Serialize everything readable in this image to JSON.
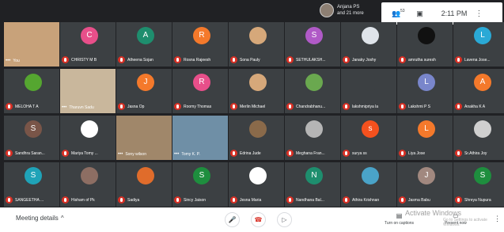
{
  "presenter": {
    "name": "Anjana PS",
    "subtitle": "and 21 more"
  },
  "top_right": {
    "people_count": "53",
    "time": "2:11 PM"
  },
  "colors": {
    "mute_red": "#d93025",
    "tile_bg": "#3c4043",
    "page_bg": "#202124"
  },
  "participants": [
    {
      "name": "You",
      "initial": "",
      "color": "#c8a27a",
      "kind": "photo",
      "muted": false
    },
    {
      "name": "CHRISTY M B",
      "initial": "C",
      "color": "#e84f8a",
      "muted": true
    },
    {
      "name": "Atheena Sojan",
      "initial": "A",
      "color": "#1e8e6e",
      "muted": true
    },
    {
      "name": "Rosna Rajeesh",
      "initial": "R",
      "color": "#f4792b",
      "muted": true
    },
    {
      "name": "Sona Pauly",
      "initial": "",
      "color": "#d6a87a",
      "muted": true
    },
    {
      "name": "SETHULAKSH...",
      "initial": "S",
      "color": "#b05ac7",
      "muted": true
    },
    {
      "name": "Janaky Joshy",
      "initial": "",
      "color": "#dfe4ea",
      "muted": true
    },
    {
      "name": "amrutha suresh",
      "initial": "",
      "color": "#111111",
      "muted": true
    },
    {
      "name": "Lavena Jose...",
      "initial": "L",
      "color": "#2aa9d6",
      "muted": true
    },
    {
      "name": "MELOHA T A",
      "initial": "",
      "color": "#55a630",
      "muted": true
    },
    {
      "name": "Tharuvn Sadu",
      "initial": "",
      "color": "#c9b79c",
      "kind": "video",
      "muted": false
    },
    {
      "name": "Jasna Op",
      "initial": "J",
      "color": "#f4792b",
      "muted": true
    },
    {
      "name": "Roomy Thomas",
      "initial": "R",
      "color": "#e84f8a",
      "muted": true
    },
    {
      "name": "Merlin Michael",
      "initial": "",
      "color": "#d6a87a",
      "muted": true
    },
    {
      "name": "Chandrabhanu...",
      "initial": "",
      "color": "#6aa84f",
      "muted": true
    },
    {
      "name": "lakshmipriya la",
      "initial": "",
      "color": "#3c4043",
      "muted": true
    },
    {
      "name": "Lakshmi P S",
      "initial": "L",
      "color": "#7986cb",
      "muted": true
    },
    {
      "name": "Anakha K A",
      "initial": "A",
      "color": "#f4792b",
      "muted": true
    },
    {
      "name": "Sandhra Saran...",
      "initial": "S",
      "color": "#795548",
      "muted": true
    },
    {
      "name": "Mariya Tomy ...",
      "initial": "",
      "color": "#ffffff",
      "muted": true
    },
    {
      "name": "Sony wilson",
      "initial": "",
      "color": "#a0876a",
      "kind": "video",
      "muted": false
    },
    {
      "name": "Tomy K. P.",
      "initial": "",
      "color": "#6f8fa6",
      "kind": "video",
      "muted": false
    },
    {
      "name": "Edrina Jude",
      "initial": "",
      "color": "#8a6a4a",
      "muted": true
    },
    {
      "name": "Meghana Fran...",
      "initial": "",
      "color": "#b5b5b5",
      "muted": true
    },
    {
      "name": "surya ss",
      "initial": "s",
      "color": "#f4511e",
      "muted": true
    },
    {
      "name": "Liya Jose",
      "initial": "L",
      "color": "#f4792b",
      "muted": true
    },
    {
      "name": "Sr.Athira Joy",
      "initial": "",
      "color": "#cfcfcf",
      "muted": true
    },
    {
      "name": "SANGEETHA ...",
      "initial": "S",
      "color": "#1fa3b8",
      "muted": true
    },
    {
      "name": "Hisham of Pk",
      "initial": "",
      "color": "#8d6e63",
      "muted": true
    },
    {
      "name": "Sadiya",
      "initial": "",
      "color": "#e06c2b",
      "muted": true
    },
    {
      "name": "Sincy Jaison",
      "initial": "S",
      "color": "#1e8e3e",
      "muted": true
    },
    {
      "name": "Jesna Maria",
      "initial": "",
      "color": "#ffffff",
      "muted": true
    },
    {
      "name": "Nandhana Bal...",
      "initial": "N",
      "color": "#1e8e6e",
      "muted": true
    },
    {
      "name": "Athira Krishnan",
      "initial": "",
      "color": "#4aa3c8",
      "muted": true
    },
    {
      "name": "Jasma Babu",
      "initial": "J",
      "color": "#a1887f",
      "muted": true
    },
    {
      "name": "Shreya Nupura",
      "initial": "S",
      "color": "#1e8e3e",
      "muted": true
    }
  ],
  "bottom": {
    "meeting_details": "Meeting details",
    "chevron": "^",
    "turn_on_captions": "Turn on captions",
    "present_now": "Present now",
    "watermark": "Activate Windows",
    "watermark_sub": "Go to Settings to activate Windows."
  }
}
